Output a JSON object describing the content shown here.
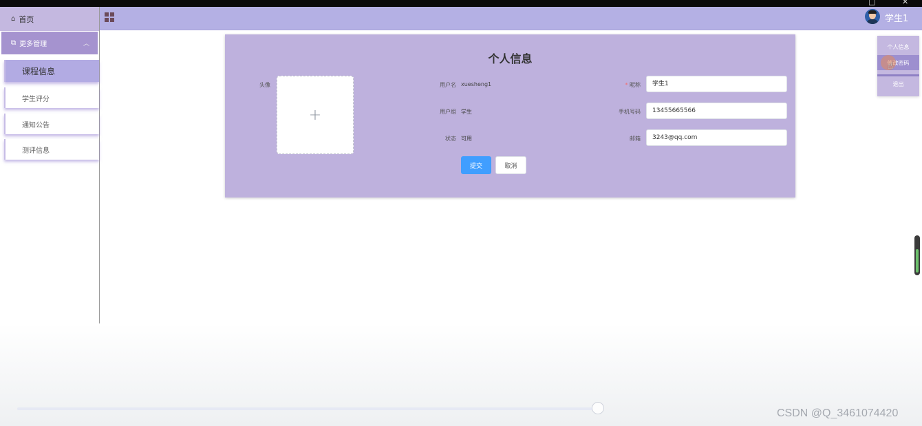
{
  "window": {
    "min_glyph": "□",
    "close_glyph": "✕"
  },
  "sidebar": {
    "home_label": "首页",
    "home_icon": "home-icon",
    "group_label": "更多管理",
    "group_icon": "copy-icon",
    "items": [
      {
        "label": "课程信息",
        "active": true
      },
      {
        "label": "学生评分",
        "active": false
      },
      {
        "label": "通知公告",
        "active": false
      },
      {
        "label": "测评信息",
        "active": false
      }
    ]
  },
  "header": {
    "menu_icon": "grid-icon",
    "user_name": "学生1"
  },
  "dropdown": {
    "items": [
      "个人信息",
      "修改密码",
      "退出"
    ],
    "hover_index": 1
  },
  "form": {
    "title": "个人信息",
    "avatar_label": "头像",
    "username_label": "用户名",
    "username_value": "xuesheng1",
    "role_label": "用户组",
    "role_value": "学生",
    "status_label": "状态",
    "status_value": "可用",
    "nickname_label": "昵称",
    "nickname_value": "学生1",
    "phone_label": "手机号码",
    "phone_value": "13455665566",
    "email_label": "邮箱",
    "email_value": "3243@qq.com",
    "submit_label": "提交",
    "cancel_label": "取消"
  },
  "footer": {
    "watermark": "CSDN @Q_3461074420"
  },
  "colors": {
    "accent": "#409eff",
    "header": "#b4b0e4",
    "panel": "#beb1dd",
    "sidebar_group": "#a593cf"
  }
}
